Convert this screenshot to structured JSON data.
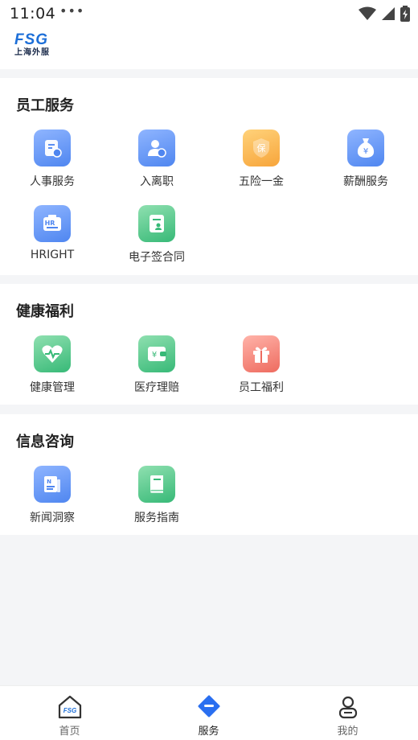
{
  "status_bar": {
    "time": "11:04",
    "dots": "•••"
  },
  "header": {
    "logo_text": "FSG",
    "logo_subtitle": "上海外服"
  },
  "sections": [
    {
      "title": "员工服务",
      "items": [
        {
          "label": "人事服务",
          "icon": "hr-service-icon",
          "color": "#5b8ff2"
        },
        {
          "label": "入离职",
          "icon": "onboarding-icon",
          "color": "#5b8ff2"
        },
        {
          "label": "五险一金",
          "icon": "insurance-icon",
          "color": "#f7a53b",
          "glyph": "保"
        },
        {
          "label": "薪酬服务",
          "icon": "salary-icon",
          "color": "#5b8ff2",
          "glyph": "¥"
        },
        {
          "label": "HRIGHT",
          "icon": "hright-icon",
          "color": "#5b8ff2",
          "glyph": "HR"
        },
        {
          "label": "电子签合同",
          "icon": "e-contract-icon",
          "color": "#37b977"
        }
      ]
    },
    {
      "title": "健康福利",
      "items": [
        {
          "label": "健康管理",
          "icon": "health-icon",
          "color": "#37b977"
        },
        {
          "label": "医疗理赔",
          "icon": "medical-claim-icon",
          "color": "#37b977",
          "glyph": "¥"
        },
        {
          "label": "员工福利",
          "icon": "gift-icon",
          "color": "#ee6b5f"
        }
      ]
    },
    {
      "title": "信息咨询",
      "items": [
        {
          "label": "新闻洞察",
          "icon": "news-icon",
          "color": "#5b8ff2",
          "glyph": "N"
        },
        {
          "label": "服务指南",
          "icon": "guide-icon",
          "color": "#37b977"
        }
      ]
    }
  ],
  "tab_bar": [
    {
      "label": "首页",
      "icon": "home-icon",
      "active": false,
      "glyph": "FSG"
    },
    {
      "label": "服务",
      "icon": "service-icon",
      "active": true
    },
    {
      "label": "我的",
      "icon": "profile-icon",
      "active": false
    }
  ]
}
